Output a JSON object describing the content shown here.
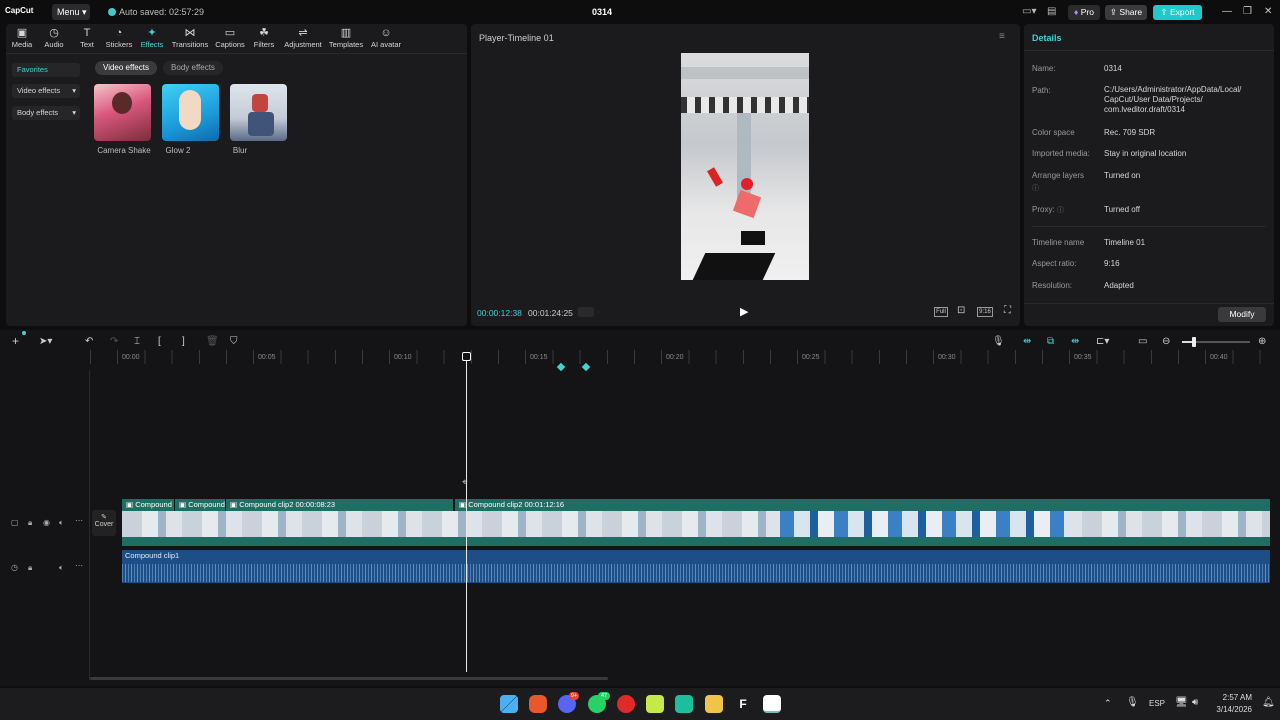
{
  "app": {
    "logo": "CapCut",
    "menu_label": "Menu",
    "saved_text": "Auto saved: 02:57:29",
    "project_title": "0314"
  },
  "header_right": {
    "pro_label": "Pro",
    "share_label": "Share",
    "export_label": "Export",
    "accent": "#1fc9c9"
  },
  "toolbar": [
    {
      "label": "Media",
      "icon": "media-icon"
    },
    {
      "label": "Audio",
      "icon": "audio-icon"
    },
    {
      "label": "Text",
      "icon": "text-icon"
    },
    {
      "label": "Stickers",
      "icon": "sticker-icon"
    },
    {
      "label": "Effects",
      "icon": "effects-icon"
    },
    {
      "label": "Transitions",
      "icon": "transition-icon"
    },
    {
      "label": "Captions",
      "icon": "captions-icon"
    },
    {
      "label": "Filters",
      "icon": "filters-icon"
    },
    {
      "label": "Adjustment",
      "icon": "adjustment-icon"
    },
    {
      "label": "Templates",
      "icon": "templates-icon"
    },
    {
      "label": "AI avatar",
      "icon": "avatar-icon"
    }
  ],
  "effects_sidebar": {
    "favorites": "Favorites",
    "video_effects": "Video effects",
    "body_effects": "Body effects"
  },
  "effects_tabs": {
    "video": "Video effects",
    "body": "Body effects"
  },
  "effects_items": [
    {
      "label": "Camera Shake"
    },
    {
      "label": "Glow 2"
    },
    {
      "label": "Blur"
    }
  ],
  "player": {
    "title": "Player-Timeline 01",
    "current_time": "00:00:12:38",
    "total_time": "00:01:24:25",
    "full_label": "Full",
    "ratio_label": "9:16"
  },
  "details": {
    "title": "Details",
    "rows": [
      {
        "key": "Name:",
        "value": "0314"
      },
      {
        "key": "Path:",
        "value": "C:/Users/Administrator/AppData/Local/ CapCut/User Data/Projects/ com.lveditor.draft/0314"
      },
      {
        "key": "Color space",
        "value": "Rec. 709 SDR"
      },
      {
        "key": "Imported media:",
        "value": "Stay in original location"
      },
      {
        "key": "Arrange layers",
        "value": "Turned on"
      },
      {
        "key": "Proxy:",
        "value": "Turned off"
      },
      {
        "key": "Timeline name",
        "value": "Timeline 01"
      },
      {
        "key": "Aspect ratio:",
        "value": "9:16"
      },
      {
        "key": "Resolution:",
        "value": "Adapted"
      }
    ],
    "modify_label": "Modify"
  },
  "ruler": [
    "00:00",
    "00:05",
    "00:10",
    "00:15",
    "00:20",
    "00:25",
    "00:30",
    "00:35",
    "00:40"
  ],
  "tracks": {
    "cover_label": "Cover",
    "video_clips": [
      {
        "label": "Compound"
      },
      {
        "label": "Compound"
      },
      {
        "label": "Compound clip2  00:00:08:23"
      },
      {
        "label": "Compound clip2  00:01:12:16"
      }
    ],
    "audio_clip": "Compound clip1"
  },
  "taskbar": {
    "lang": "ESP",
    "time": "2:57 AM",
    "date": "3/14/2026",
    "badge_count": "47"
  }
}
